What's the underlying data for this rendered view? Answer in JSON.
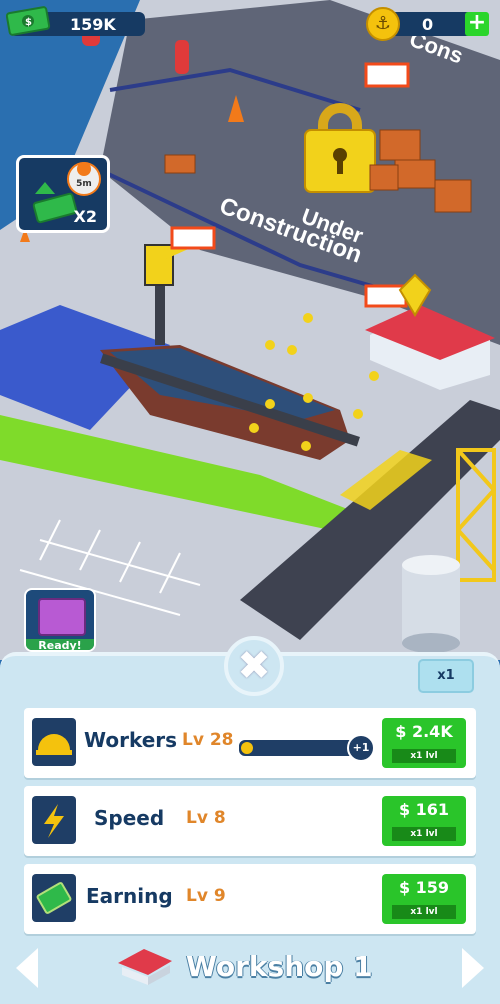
{
  "hud": {
    "cash": "159K",
    "anchor_count": "0",
    "plus_label": "+"
  },
  "boost": {
    "multiplier": "X2",
    "timer": "5m"
  },
  "scene": {
    "construction_label_1": "Under",
    "construction_label_2": "Construction",
    "partial_label": "Cons"
  },
  "chest": {
    "status": "Ready!"
  },
  "panel": {
    "close_label": "✖",
    "multiplier_label": "x1",
    "rows": [
      {
        "name": "Workers",
        "level": "Lv 28",
        "price": "$ 2.4K",
        "per": "x1 lvl",
        "progress": 0.1,
        "bonus": "+1"
      },
      {
        "name": "Speed",
        "level": "Lv 8",
        "price": "$  161",
        "per": "x1 lvl"
      },
      {
        "name": "Earning",
        "level": "Lv 9",
        "price": "$  159",
        "per": "x1 lvl"
      }
    ],
    "title": "Workshop 1"
  },
  "colors": {
    "water": "#2a6fb0",
    "panel": "#cde6f2",
    "navy": "#163a63",
    "buy_green": "#2ac52a",
    "level_orange": "#e0862a"
  }
}
